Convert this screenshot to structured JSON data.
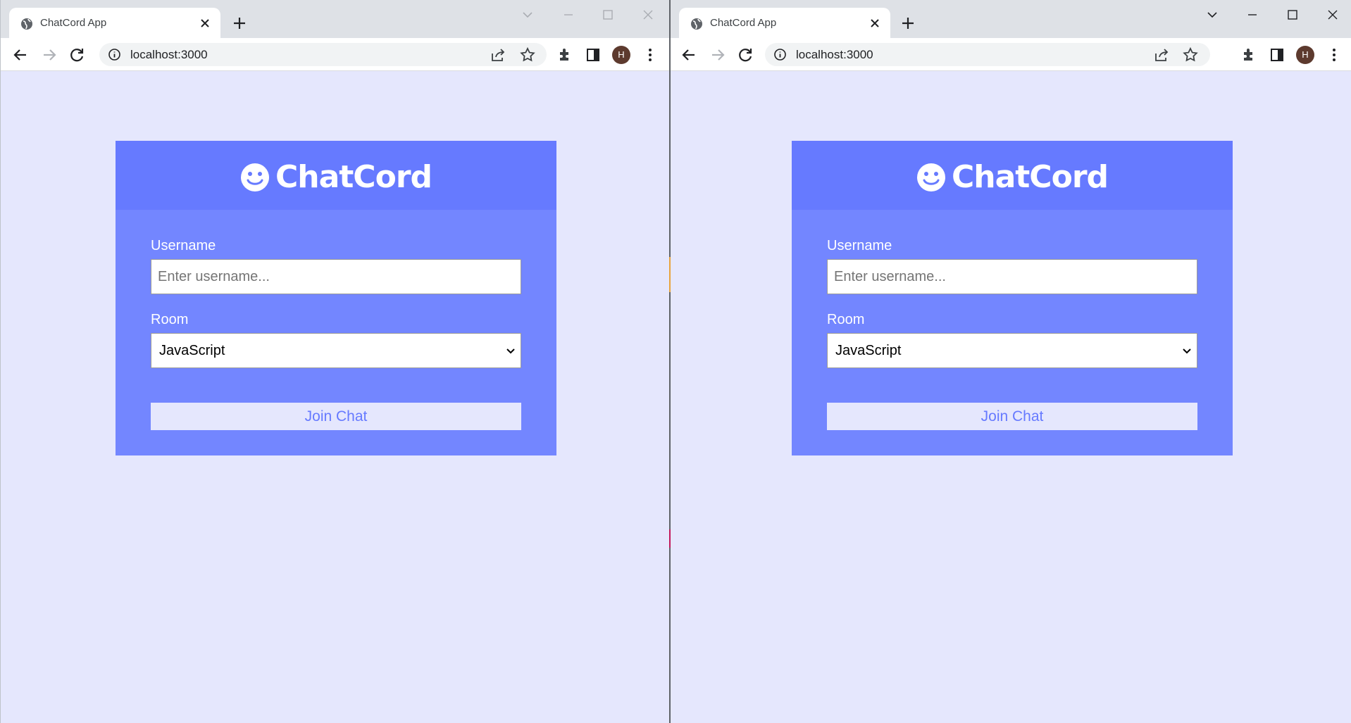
{
  "colors": {
    "page_bg": "#e5e7fd",
    "card_header": "#667aff",
    "card_body": "#7386ff",
    "button_bg": "#e5e7fd",
    "button_text": "#667aff",
    "avatar_bg": "#5d3a2e"
  },
  "windows": [
    {
      "tab": {
        "title": "ChatCord App",
        "icon": "globe-icon"
      },
      "address": {
        "url": "localhost:3000"
      },
      "profile": {
        "initial": "H"
      },
      "card": {
        "brand": "ChatCord",
        "username_label": "Username",
        "username_placeholder": "Enter username...",
        "room_label": "Room",
        "room_selected": "JavaScript",
        "join_button": "Join Chat"
      }
    },
    {
      "tab": {
        "title": "ChatCord App",
        "icon": "globe-icon"
      },
      "address": {
        "url": "localhost:3000"
      },
      "profile": {
        "initial": "H"
      },
      "card": {
        "brand": "ChatCord",
        "username_label": "Username",
        "username_placeholder": "Enter username...",
        "room_label": "Room",
        "room_selected": "JavaScript",
        "join_button": "Join Chat"
      }
    }
  ]
}
